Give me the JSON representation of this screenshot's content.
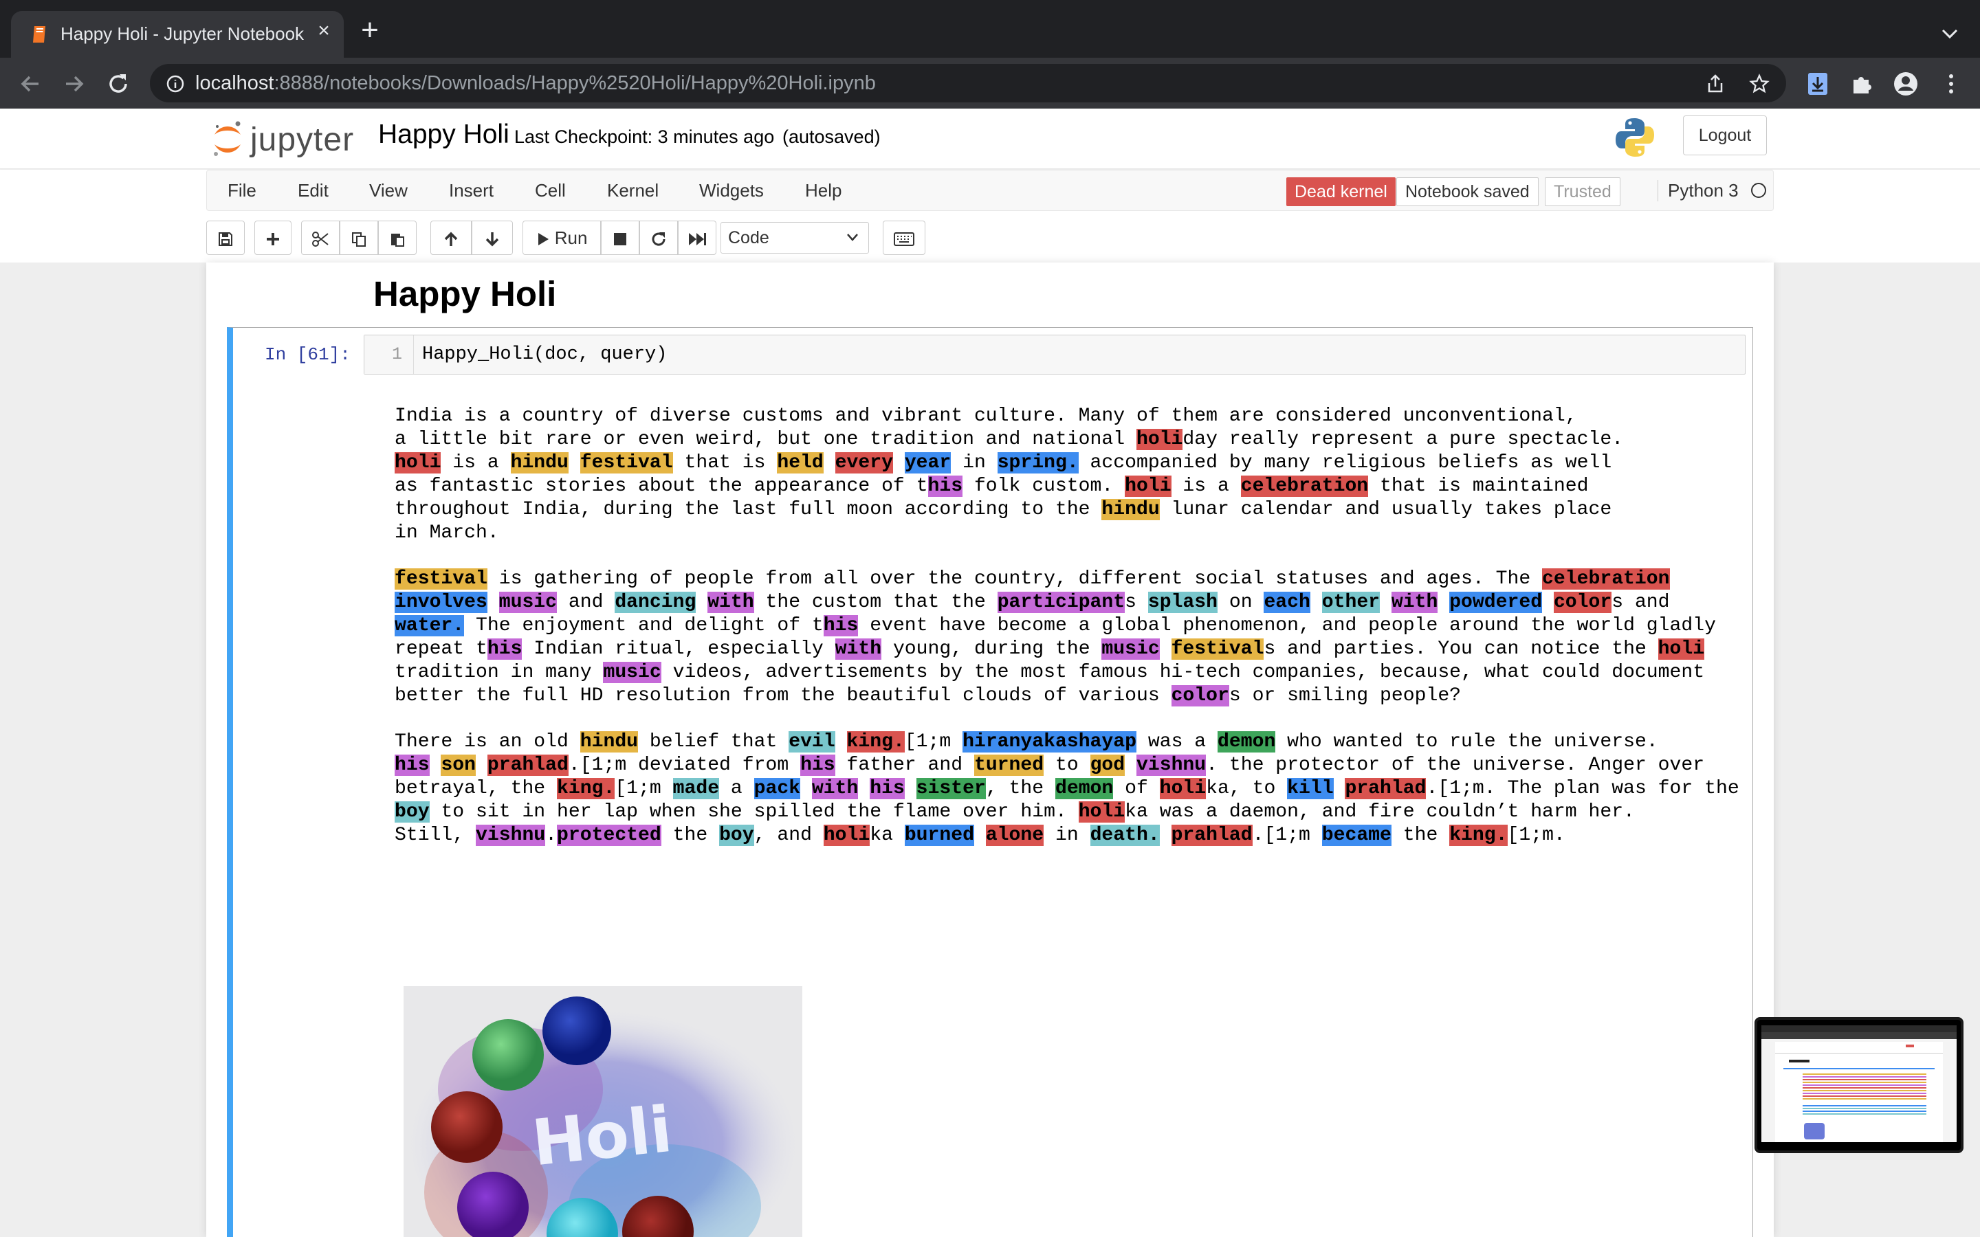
{
  "browser": {
    "tab_title": "Happy Holi - Jupyter Notebook",
    "url_host": "localhost",
    "url_rest": ":8888/notebooks/Downloads/Happy%2520Holi/Happy%20Holi.ipynb"
  },
  "jupyter": {
    "logo_text": "jupyter",
    "notebook_title": "Happy Holi",
    "checkpoint": "Last Checkpoint: 3 minutes ago",
    "autosave": "(autosaved)",
    "logout_label": "Logout",
    "menu": [
      "File",
      "Edit",
      "View",
      "Insert",
      "Cell",
      "Kernel",
      "Widgets",
      "Help"
    ],
    "status_dead_kernel": "Dead kernel",
    "status_saved": "Notebook saved",
    "status_trusted": "Trusted",
    "kernel_name": "Python 3",
    "run_label": "Run",
    "cell_type": "Code"
  },
  "notebook": {
    "heading": "Happy Holi",
    "cell": {
      "prompt": "In [61]:",
      "line_number": "1",
      "code": "Happy_Holi(doc, query)"
    },
    "output_highlight_colors": {
      "yellow": "#e5b544",
      "red": "#d9534f",
      "blue": "#3d8cf0",
      "purple": "#c56ad8",
      "cyan": "#79c6cc",
      "green": "#3ea55a"
    },
    "output_paragraphs": [
      [
        [
          [
            "t",
            "India is a country of diverse customs and vibrant culture. Many of them are considered unconventional,"
          ]
        ],
        [
          [
            "t",
            "a little bit rare or even weird, but one tradition and national "
          ],
          [
            "r",
            "holi"
          ],
          [
            "t",
            "day really represent a pure spectacle."
          ]
        ],
        [
          [
            "r",
            "holi"
          ],
          [
            "t",
            " is a "
          ],
          [
            "y",
            "hindu"
          ],
          [
            "t",
            " "
          ],
          [
            "y",
            "festival"
          ],
          [
            "t",
            " that is "
          ],
          [
            "y",
            "held"
          ],
          [
            "t",
            " "
          ],
          [
            "r",
            "every"
          ],
          [
            "t",
            " "
          ],
          [
            "b",
            "year"
          ],
          [
            "t",
            " in "
          ],
          [
            "b",
            "spring."
          ],
          [
            "t",
            " accompanied by many religious beliefs as well"
          ]
        ],
        [
          [
            "t",
            "as fantastic stories about the appearance of t"
          ],
          [
            "p",
            "his"
          ],
          [
            "t",
            " folk custom. "
          ],
          [
            "r",
            "holi"
          ],
          [
            "t",
            " is a "
          ],
          [
            "r",
            "celebration"
          ],
          [
            "t",
            " that is maintained"
          ]
        ],
        [
          [
            "t",
            "throughout India, during the last full moon according to the "
          ],
          [
            "y",
            "hindu"
          ],
          [
            "t",
            " lunar calendar and usually takes place"
          ]
        ],
        [
          [
            "t",
            "in March."
          ]
        ]
      ],
      [
        [
          [
            "y",
            "festival"
          ],
          [
            "t",
            " is gathering of people from all over the country, different social statuses and ages. The "
          ],
          [
            "r",
            "celebration"
          ]
        ],
        [
          [
            "b",
            "involves"
          ],
          [
            "t",
            " "
          ],
          [
            "p",
            "music"
          ],
          [
            "t",
            " and "
          ],
          [
            "c",
            "dancing"
          ],
          [
            "t",
            " "
          ],
          [
            "p",
            "with"
          ],
          [
            "t",
            " the custom that the "
          ],
          [
            "p",
            "participant"
          ],
          [
            "t",
            "s "
          ],
          [
            "c",
            "splash"
          ],
          [
            "t",
            " on "
          ],
          [
            "b",
            "each"
          ],
          [
            "t",
            " "
          ],
          [
            "c",
            "other"
          ],
          [
            "t",
            " "
          ],
          [
            "p",
            "with"
          ],
          [
            "t",
            " "
          ],
          [
            "b",
            "powdered"
          ],
          [
            "t",
            " "
          ],
          [
            "r",
            "color"
          ],
          [
            "t",
            "s and"
          ]
        ],
        [
          [
            "b",
            "water."
          ],
          [
            "t",
            " The enjoyment and delight of t"
          ],
          [
            "p",
            "his"
          ],
          [
            "t",
            " event have become a global phenomenon, and people around the world gladly"
          ]
        ],
        [
          [
            "t",
            "repeat t"
          ],
          [
            "p",
            "his"
          ],
          [
            "t",
            " Indian ritual, especially "
          ],
          [
            "p",
            "with"
          ],
          [
            "t",
            " young, during the "
          ],
          [
            "p",
            "music"
          ],
          [
            "t",
            " "
          ],
          [
            "y",
            "festival"
          ],
          [
            "t",
            "s and parties. You can notice the "
          ],
          [
            "r",
            "holi"
          ]
        ],
        [
          [
            "t",
            "tradition in many "
          ],
          [
            "p",
            "music"
          ],
          [
            "t",
            " videos, advertisements by the most famous hi-tech companies, because, what could document"
          ]
        ],
        [
          [
            "t",
            "better the full HD resolution from the beautiful clouds of various "
          ],
          [
            "p",
            "color"
          ],
          [
            "t",
            "s or smiling people?"
          ]
        ]
      ],
      [
        [
          [
            "t",
            "There is an old "
          ],
          [
            "y",
            "hindu"
          ],
          [
            "t",
            " belief that "
          ],
          [
            "c",
            "evil"
          ],
          [
            "t",
            " "
          ],
          [
            "r",
            "king."
          ],
          [
            "t",
            "[1;m "
          ],
          [
            "b",
            "hiranyakashayap"
          ],
          [
            "t",
            " was a "
          ],
          [
            "g",
            "demon"
          ],
          [
            "t",
            " who wanted to rule the universe."
          ]
        ],
        [
          [
            "p",
            "his"
          ],
          [
            "t",
            " "
          ],
          [
            "y",
            "son"
          ],
          [
            "t",
            " "
          ],
          [
            "r",
            "prahlad"
          ],
          [
            "t",
            ".[1;m deviated from "
          ],
          [
            "p",
            "his"
          ],
          [
            "t",
            " father and "
          ],
          [
            "y",
            "turned"
          ],
          [
            "t",
            " to "
          ],
          [
            "y",
            "god"
          ],
          [
            "t",
            " "
          ],
          [
            "p",
            "vishnu"
          ],
          [
            "t",
            ". the protector of the universe. Anger over"
          ]
        ],
        [
          [
            "t",
            "betrayal, the "
          ],
          [
            "r",
            "king."
          ],
          [
            "t",
            "[1;m "
          ],
          [
            "c",
            "made"
          ],
          [
            "t",
            " a "
          ],
          [
            "b",
            "pack"
          ],
          [
            "t",
            " "
          ],
          [
            "p",
            "with"
          ],
          [
            "t",
            " "
          ],
          [
            "p",
            "his"
          ],
          [
            "t",
            " "
          ],
          [
            "g",
            "sister"
          ],
          [
            "t",
            ", the "
          ],
          [
            "g",
            "demon"
          ],
          [
            "t",
            " of "
          ],
          [
            "r",
            "holi"
          ],
          [
            "t",
            "ka, to "
          ],
          [
            "b",
            "kill"
          ],
          [
            "t",
            " "
          ],
          [
            "r",
            "prahlad"
          ],
          [
            "t",
            ".[1;m. The plan was for the"
          ]
        ],
        [
          [
            "c",
            "boy"
          ],
          [
            "t",
            " to sit in her lap when she spilled the flame over him. "
          ],
          [
            "r",
            "holi"
          ],
          [
            "t",
            "ka was a daemon, and fire couldn’t harm her."
          ]
        ],
        [
          [
            "t",
            "Still, "
          ],
          [
            "p",
            "vishnu"
          ],
          [
            "t",
            "."
          ],
          [
            "p",
            "protected"
          ],
          [
            "t",
            " the "
          ],
          [
            "c",
            "boy"
          ],
          [
            "t",
            ", and "
          ],
          [
            "r",
            "holi"
          ],
          [
            "t",
            "ka "
          ],
          [
            "b",
            "burned"
          ],
          [
            "t",
            " "
          ],
          [
            "r",
            "alone"
          ],
          [
            "t",
            " in "
          ],
          [
            "c",
            "death."
          ],
          [
            "t",
            " "
          ],
          [
            "r",
            "prahlad"
          ],
          [
            "t",
            ".[1;m "
          ],
          [
            "b",
            "became"
          ],
          [
            "t",
            " the "
          ],
          [
            "r",
            "king."
          ],
          [
            "t",
            "[1;m."
          ]
        ]
      ]
    ],
    "image_text": "Holi"
  }
}
